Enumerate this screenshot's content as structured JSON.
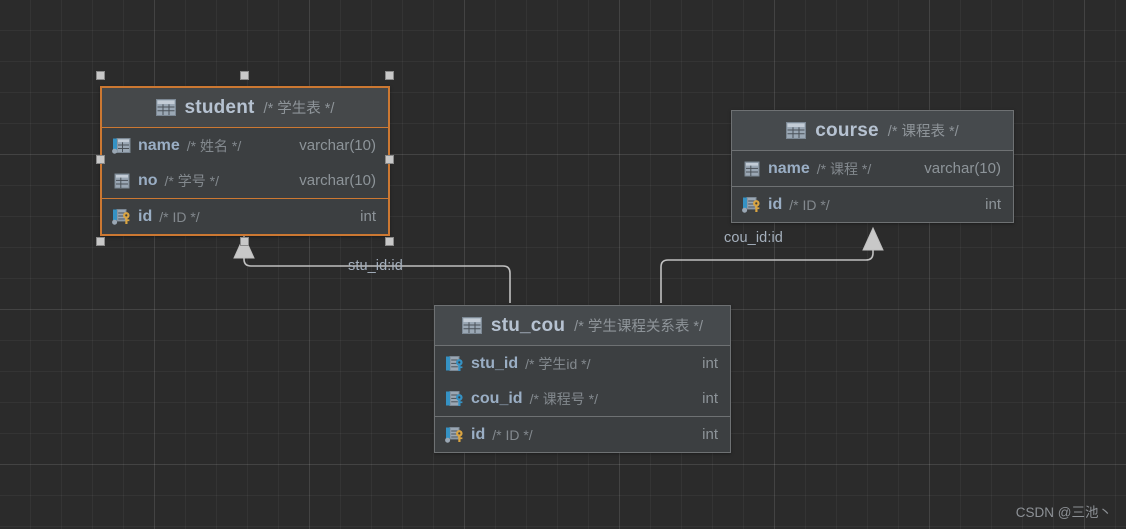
{
  "canvas": {
    "background": "#2b2b2b",
    "grid_color": "#383838",
    "watermark": "CSDN @三池丶"
  },
  "entities": [
    {
      "id": "student",
      "name": "student",
      "comment": "/* 学生表 */",
      "selected": true,
      "table_icon": "table-icon",
      "columns": [
        {
          "name": "name",
          "comment": "/* 姓名 */",
          "type": "varchar(10)",
          "icon": "indexed-column-icon",
          "key": "none"
        },
        {
          "name": "no",
          "comment": "/* 学号 */",
          "type": "varchar(10)",
          "icon": "column-icon",
          "key": "none"
        },
        {
          "name": "id",
          "comment": "/* ID */",
          "type": "int",
          "icon": "primary-key-column-icon",
          "key": "primary"
        }
      ]
    },
    {
      "id": "course",
      "name": "course",
      "comment": "/* 课程表 */",
      "selected": false,
      "table_icon": "table-icon",
      "columns": [
        {
          "name": "name",
          "comment": "/* 课程 */",
          "type": "varchar(10)",
          "icon": "column-icon",
          "key": "none"
        },
        {
          "name": "id",
          "comment": "/* ID */",
          "type": "int",
          "icon": "primary-key-column-icon",
          "key": "primary"
        }
      ]
    },
    {
      "id": "stu_cou",
      "name": "stu_cou",
      "comment": "/* 学生课程关系表 */",
      "selected": false,
      "table_icon": "table-icon",
      "columns": [
        {
          "name": "stu_id",
          "comment": "/* 学生id */",
          "type": "int",
          "icon": "foreign-key-column-icon",
          "key": "foreign"
        },
        {
          "name": "cou_id",
          "comment": "/* 课程号 */",
          "type": "int",
          "icon": "foreign-key-column-icon",
          "key": "foreign"
        },
        {
          "name": "id",
          "comment": "/* ID */",
          "type": "int",
          "icon": "primary-key-column-icon",
          "key": "primary"
        }
      ]
    }
  ],
  "relationships": [
    {
      "id": "stu_cou-to-student",
      "label": "stu_id:id",
      "from": "stu_cou.stu_id",
      "to": "student.id"
    },
    {
      "id": "stu_cou-to-course",
      "label": "cou_id:id",
      "from": "stu_cou.cou_id",
      "to": "course.id"
    }
  ],
  "colors": {
    "accent_selection": "#cc7832",
    "entity_fill": "#3c3f41",
    "entity_header_fill": "#464a4d",
    "entity_border": "#6e7173",
    "text_primary": "#a9b7c6",
    "text_comment": "#83898e",
    "key_primary": "#d9a441",
    "key_foreign": "#3592c4",
    "link_line": "#c0c0c0"
  }
}
